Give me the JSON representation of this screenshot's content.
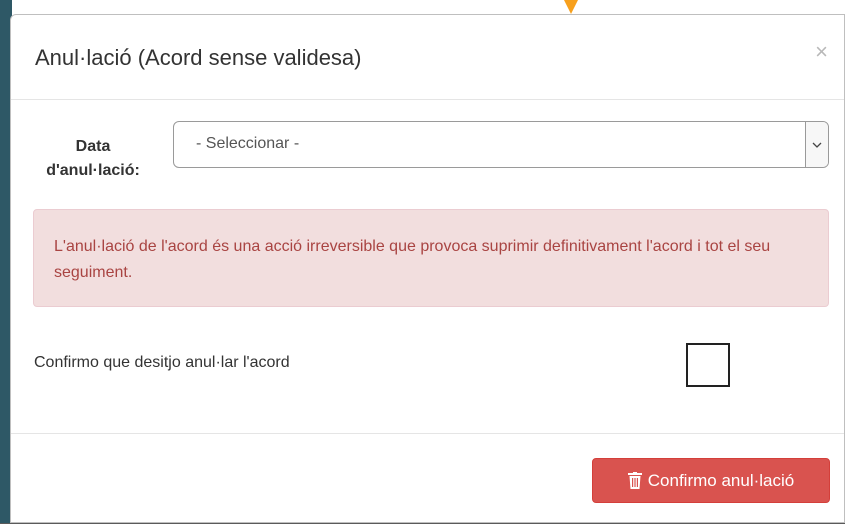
{
  "modal": {
    "title": "Anul·lació (Acord sense validesa)",
    "close_symbol": "×"
  },
  "form": {
    "date_label": "Data d'anul·lació:",
    "date_select_value": "- Seleccionar -",
    "select_icon": "chevron-down-icon"
  },
  "alert": {
    "text": "L'anul·lació de l'acord és una acció irreversible que provoca suprimir definitivament l'acord i tot el seu seguiment.",
    "background_color": "#f2dede",
    "text_color": "#a94442"
  },
  "confirm": {
    "label": "Confirmo que desitjo anul·lar l'acord",
    "checked": false
  },
  "footer": {
    "confirm_button_label": "Confirmo anul·lació",
    "confirm_button_icon": "trash-icon",
    "confirm_button_color": "#d9534f"
  }
}
